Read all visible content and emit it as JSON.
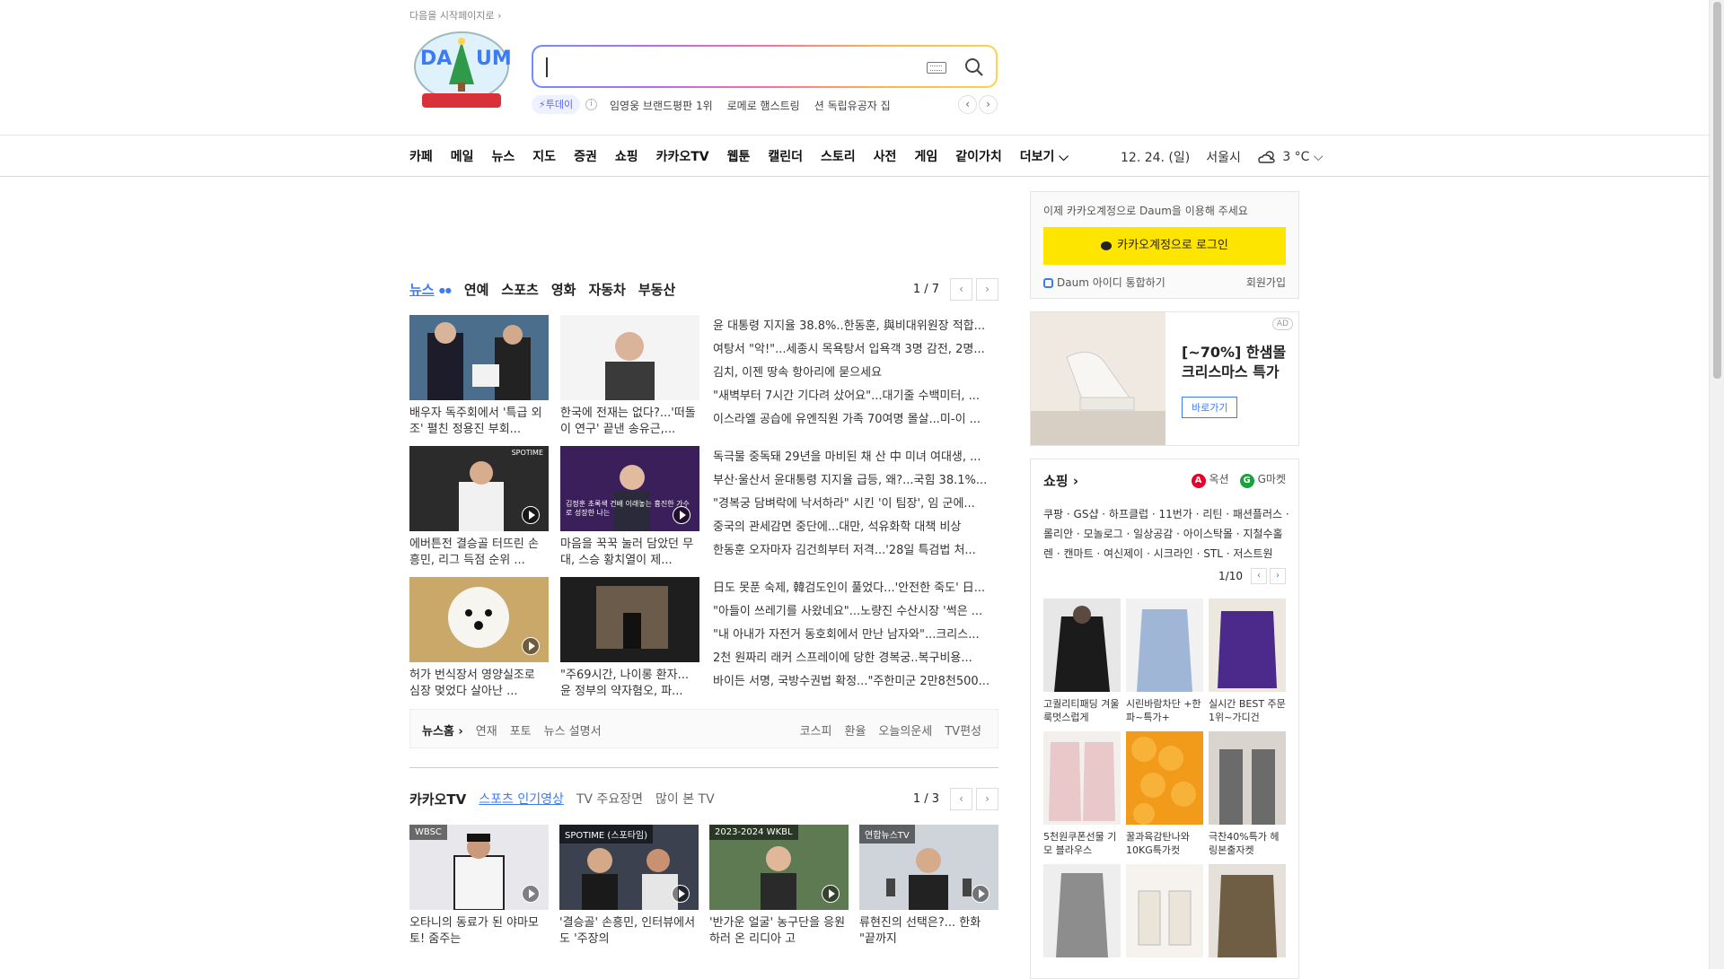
{
  "header": {
    "start_page_link": "다음을 시작페이지로 ›",
    "search": {
      "placeholder": ""
    },
    "today_badge": "⚡투데이",
    "info_icon": "i",
    "trending": [
      "임영웅 브랜드평판 1위",
      "로메로 햄스트링",
      "션 독립유공자 집"
    ],
    "prev": "‹",
    "next": "›"
  },
  "gnb": {
    "items": [
      "카페",
      "메일",
      "뉴스",
      "지도",
      "증권",
      "쇼핑",
      "카카오TV",
      "웹툰",
      "캘린더",
      "스토리",
      "사전",
      "게임",
      "같이가치",
      "더보기 ⌵"
    ],
    "date": "12. 24. (일)",
    "city": "서울시",
    "temp": "3 °C ⌵"
  },
  "news": {
    "tabs": [
      "뉴스",
      "연예",
      "스포츠",
      "영화",
      "자동차",
      "부동산"
    ],
    "tab_dot": "●●",
    "page": "1 / 7",
    "rows": [
      {
        "captions": [
          "배우자 독주회에서 '특급 외조' 펼친 정용진 부회...",
          "한국에 전재는 없다?...'떠돌이 연구' 끝낸 송유근,..."
        ],
        "headlines": [
          "윤 대통령 지지율 38.8%..한동훈, 與비대위원장 적합...",
          "여탕서 \"악!\"...세종시 목욕탕서 입욕객 3명 감전, 2명...",
          "김치, 이젠 땅속 항아리에 묻으세요",
          "\"새벽부터 7시간 기다려 샀어요\"...대기줄 수백미터, ...",
          "이스라엘 공습에 유엔직원 가족 70여명 몰살...미-이 ..."
        ]
      },
      {
        "captions": [
          "에버튼전 결승골 터뜨린 손흥민, 리그 득점 순위 ...",
          "마음을 꾹꾹 눌러 담았던 무대, 스승 황치열이 제..."
        ],
        "headlines": [
          "독극물 중독돼 29년을 마비된 채 산 中 미녀 여대생, ...",
          "부산·울산서 윤대통령 지지율 급등, 왜?...국힘 38.1%...",
          "\"경복궁 담벼락에 낙서하라\" 시킨 '이 팀장', 임 군에...",
          "중국의 관세감면 중단에...대만, 석유화학 대책 비상",
          "한동훈 오자마자 김건희부터 저격...'28일 특검법 처..."
        ]
      },
      {
        "captions": [
          "허가 번식장서 영양실조로 심장 멎었다 살아난 ...",
          "\"주69시간, 나이롱 환자... 윤 정부의 약자혐오, 파..."
        ],
        "headlines": [
          "日도 못푼 숙제, 韓검도인이 풀었다...'안전한 죽도' 日...",
          "\"아들이 쓰레기를 사왔네요\"...노량진 수산시장 '썩은 ...",
          "\"내 아내가 자전거 동호회에서 만난 남자와\"...크리스...",
          "2천 원짜리 래커 스프레이에 당한 경복궁..복구비용...",
          "바이든 서명, 국방수권법 확정...\"주한미군 2만8천500..."
        ]
      }
    ],
    "thumb_labels": [
      "SPOTIME"
    ],
    "thumb_overlay": "김정훈 초록색 건배 이래놓는 흉진한 가수로 성장한 나는",
    "footer_left": [
      "뉴스홈 ›",
      "연재",
      "포토",
      "뉴스 설명서"
    ],
    "footer_right": [
      "코스피",
      "환율",
      "오늘의운세",
      "TV편성"
    ]
  },
  "kakaotv": {
    "title": "카카오TV",
    "tabs": [
      "스포츠 인기영상",
      "TV 주요장면",
      "많이 본 TV"
    ],
    "page": "1 / 3",
    "items": [
      {
        "tag": "WBSC",
        "caption": "오타니의 동료가 된 야마모토! 줌주는"
      },
      {
        "tag": "SPOTIME (스포타임)",
        "caption": "'결승골' 손흥민, 인터뷰에서도 '주장의"
      },
      {
        "tag": "2023-2024 WKBL",
        "caption": "'반가운 얼굴' 농구단을 응원하러 온 리디아 고"
      },
      {
        "tag": "연합뉴스TV",
        "caption": "류현진의 선택은?... 한화 \"끝까지"
      }
    ]
  },
  "side": {
    "login_notice": "이제 카카오계정으로 Daum을 이용해 주세요",
    "login_button": "카카오계정으로 로그인",
    "daum_id": "Daum 아이디 통합하기",
    "join": "회원가입",
    "ad": {
      "badge": "AD",
      "text": "[~70%] 한샘몰 크리스마스 특가",
      "button": "바로가기"
    },
    "shopping": {
      "title": "쇼핑 ›",
      "brands": [
        {
          "mark": "A",
          "name": "옥션",
          "color": "#e4002b"
        },
        {
          "mark": "G",
          "name": "G마켓",
          "color": "#18a33c"
        }
      ],
      "links": "쿠팡 · GS샵 · 하프클럽 · 11번가 · 리틴 · 패션플러스 · 롤리안 · 모놀로그 · 일상공감 · 아이스탁몰 · 지철수홀렌 · 캔마트 · 여신제이 · 시크라인 · STL · 저스트원",
      "page": "1/10",
      "items": [
        "고퀄리티패딩 겨울룩멋스럽게",
        "시린바람차단 +한파~특가+",
        "실시간 BEST 주문1위~가디건",
        "5천원쿠폰선물 기모 블라우스",
        "꿀과육감탄나와 10KG특가컷",
        "극찬40%특가 헤링본출자켓",
        "",
        "",
        ""
      ]
    }
  },
  "colors": {
    "accent": "#3d7bf4",
    "kakao": "#fee500"
  }
}
